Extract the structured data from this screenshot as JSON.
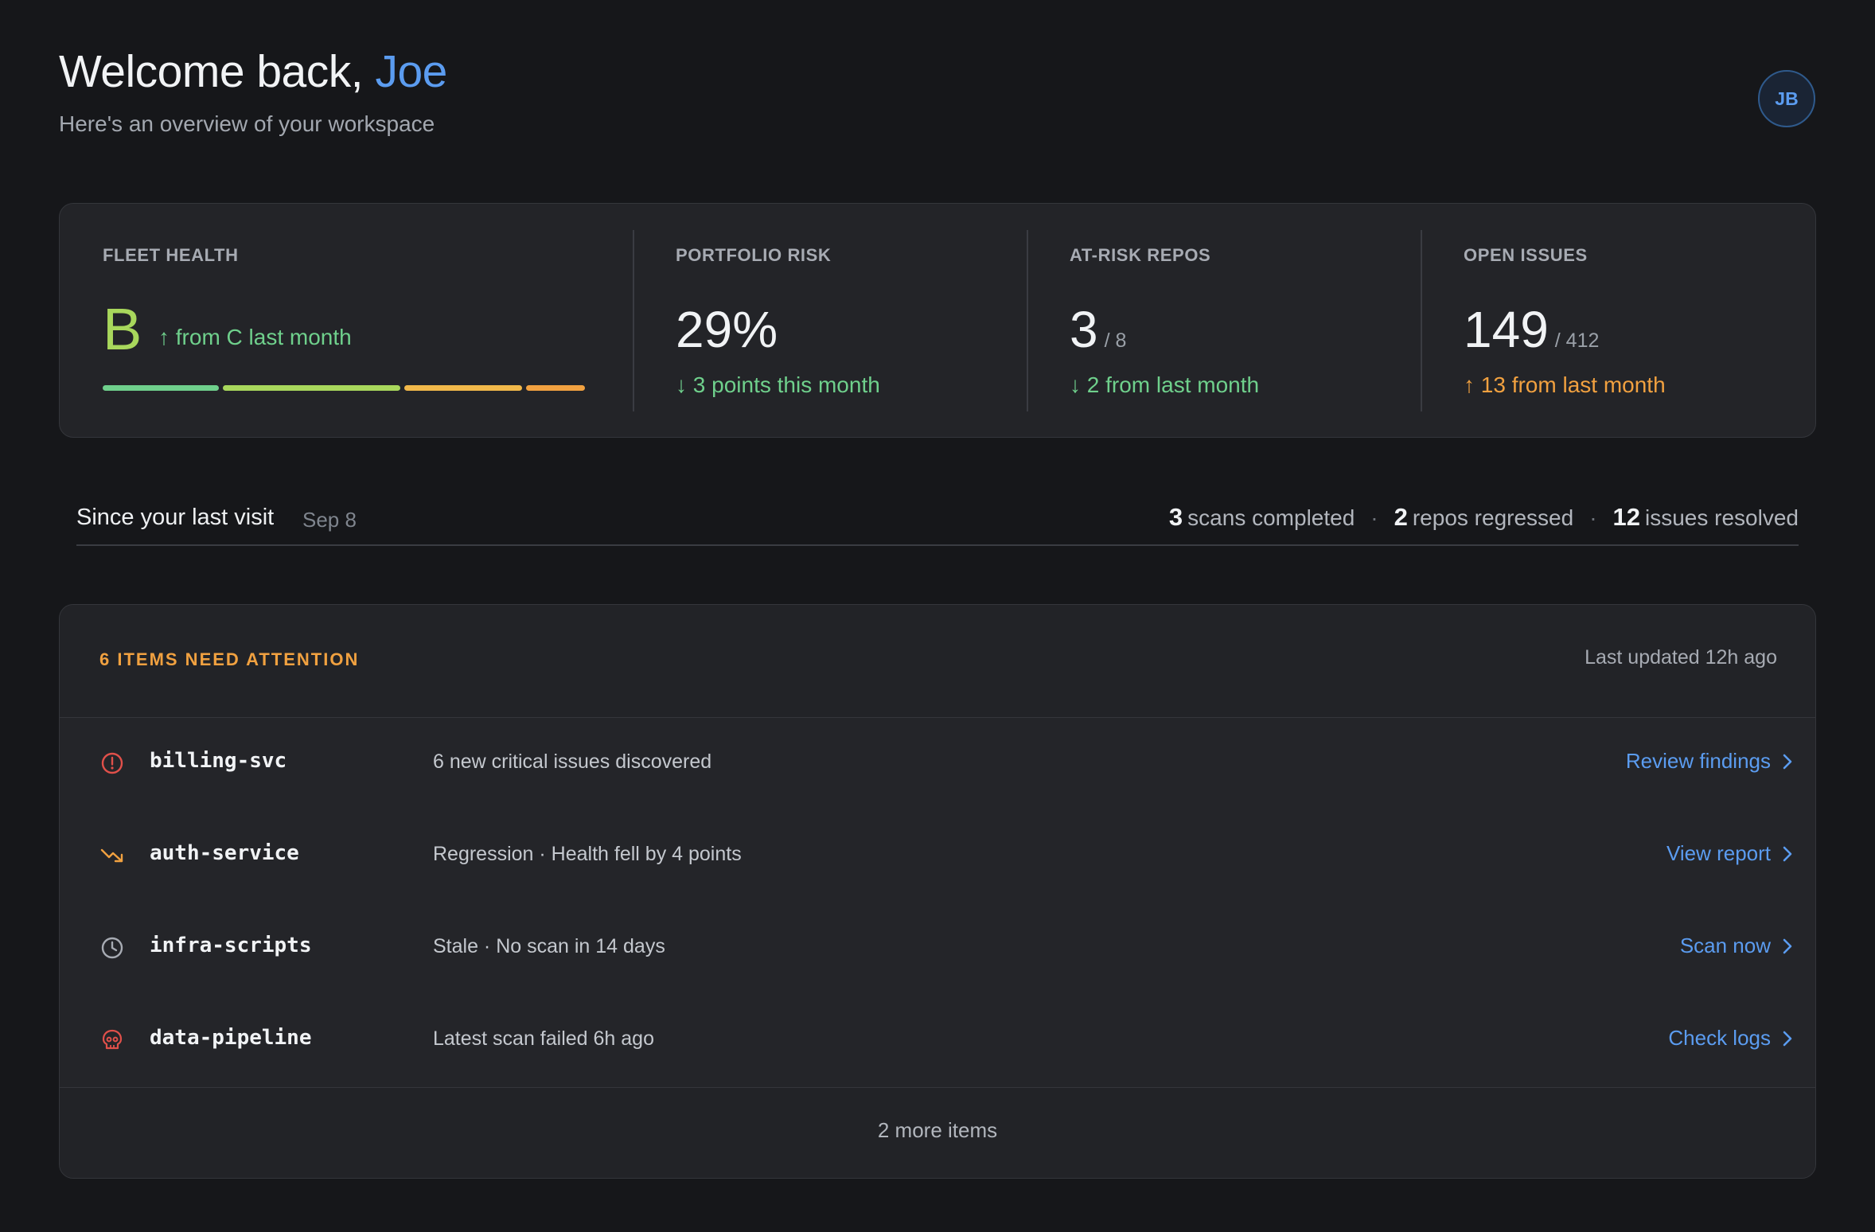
{
  "header": {
    "greeting": "Welcome back, ",
    "user_name": "Joe",
    "subtitle": "Here's an overview of your workspace",
    "avatar_initials": "JB"
  },
  "stats": {
    "fleet_health": {
      "label": "FLEET HEALTH",
      "grade": "B",
      "trend": "↑ from C last month",
      "bar_colors": [
        "#6fd08c",
        "#a8d75c",
        "#f1b84a",
        "#f1a140"
      ]
    },
    "portfolio_risk": {
      "label": "PORTFOLIO RISK",
      "value": "29%",
      "delta": "↓ 3 points this month"
    },
    "at_risk_repos": {
      "label": "AT-RISK REPOS",
      "value": "3",
      "denominator": "/ 8",
      "delta": "↓ 2 from last month"
    },
    "open_issues": {
      "label": "OPEN ISSUES",
      "value": "149",
      "denominator": "/ 412",
      "delta": "↑ 13 from last month"
    }
  },
  "since_last_visit": {
    "title": "Since your last visit",
    "date": "Sep 8",
    "items": [
      {
        "count": "3",
        "label": "scans completed"
      },
      {
        "count": "2",
        "label": "repos regressed"
      },
      {
        "count": "12",
        "label": "issues resolved"
      }
    ]
  },
  "attention": {
    "title": "6 ITEMS NEED ATTENTION",
    "updated": "Last updated 12h ago",
    "rows": [
      {
        "icon": "alert-circle-icon",
        "repo": "billing-svc",
        "desc": "6 new critical issues discovered",
        "action": "Review findings"
      },
      {
        "icon": "trending-down-icon",
        "repo": "auth-service",
        "desc": "Regression · Health fell by 4 points",
        "action": "View report"
      },
      {
        "icon": "clock-icon",
        "repo": "infra-scripts",
        "desc": "Stale · No scan in 14 days",
        "action": "Scan now"
      },
      {
        "icon": "skull-icon",
        "repo": "data-pipeline",
        "desc": "Latest scan failed 6h ago",
        "action": "Check logs"
      }
    ],
    "more": "2 more items"
  },
  "colors": {
    "accent": "#5b9cf0",
    "good": "#6fd08c",
    "warn": "#f1a140",
    "danger": "#e0504a"
  }
}
